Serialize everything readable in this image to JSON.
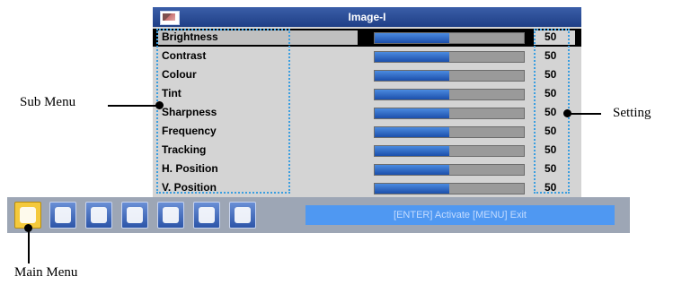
{
  "osd": {
    "title": "Image-I",
    "rows": [
      {
        "label": "Brightness",
        "value": "50",
        "level": 0.5
      },
      {
        "label": "Contrast",
        "value": "50",
        "level": 0.5
      },
      {
        "label": "Colour",
        "value": "50",
        "level": 0.5
      },
      {
        "label": "Tint",
        "value": "50",
        "level": 0.5
      },
      {
        "label": "Sharpness",
        "value": "50",
        "level": 0.5
      },
      {
        "label": "Frequency",
        "value": "50",
        "level": 0.5
      },
      {
        "label": "Tracking",
        "value": "50",
        "level": 0.5
      },
      {
        "label": "H. Position",
        "value": "50",
        "level": 0.5
      },
      {
        "label": "V. Position",
        "value": "50",
        "level": 0.5
      }
    ],
    "selected_row": "Brightness"
  },
  "menu_bar": {
    "icons": [
      "image-icon",
      "display-icon",
      "setting-icon",
      "color-icon",
      "options-icon",
      "audio-icon",
      "3d-icon"
    ],
    "selected_icon": "image-icon",
    "hint": "[ENTER]  Activate    [MENU]  Exit"
  },
  "callouts": {
    "sub_menu": "Sub Menu",
    "setting": "Setting",
    "main_menu": "Main Menu"
  },
  "colors": {
    "title_bar": "#2a4c96",
    "bar_fill": "#2a62c4",
    "highlight_dots": "#3a9ee0",
    "selected_icon": "#f4c93c",
    "hint_bar": "#4f98f2"
  }
}
